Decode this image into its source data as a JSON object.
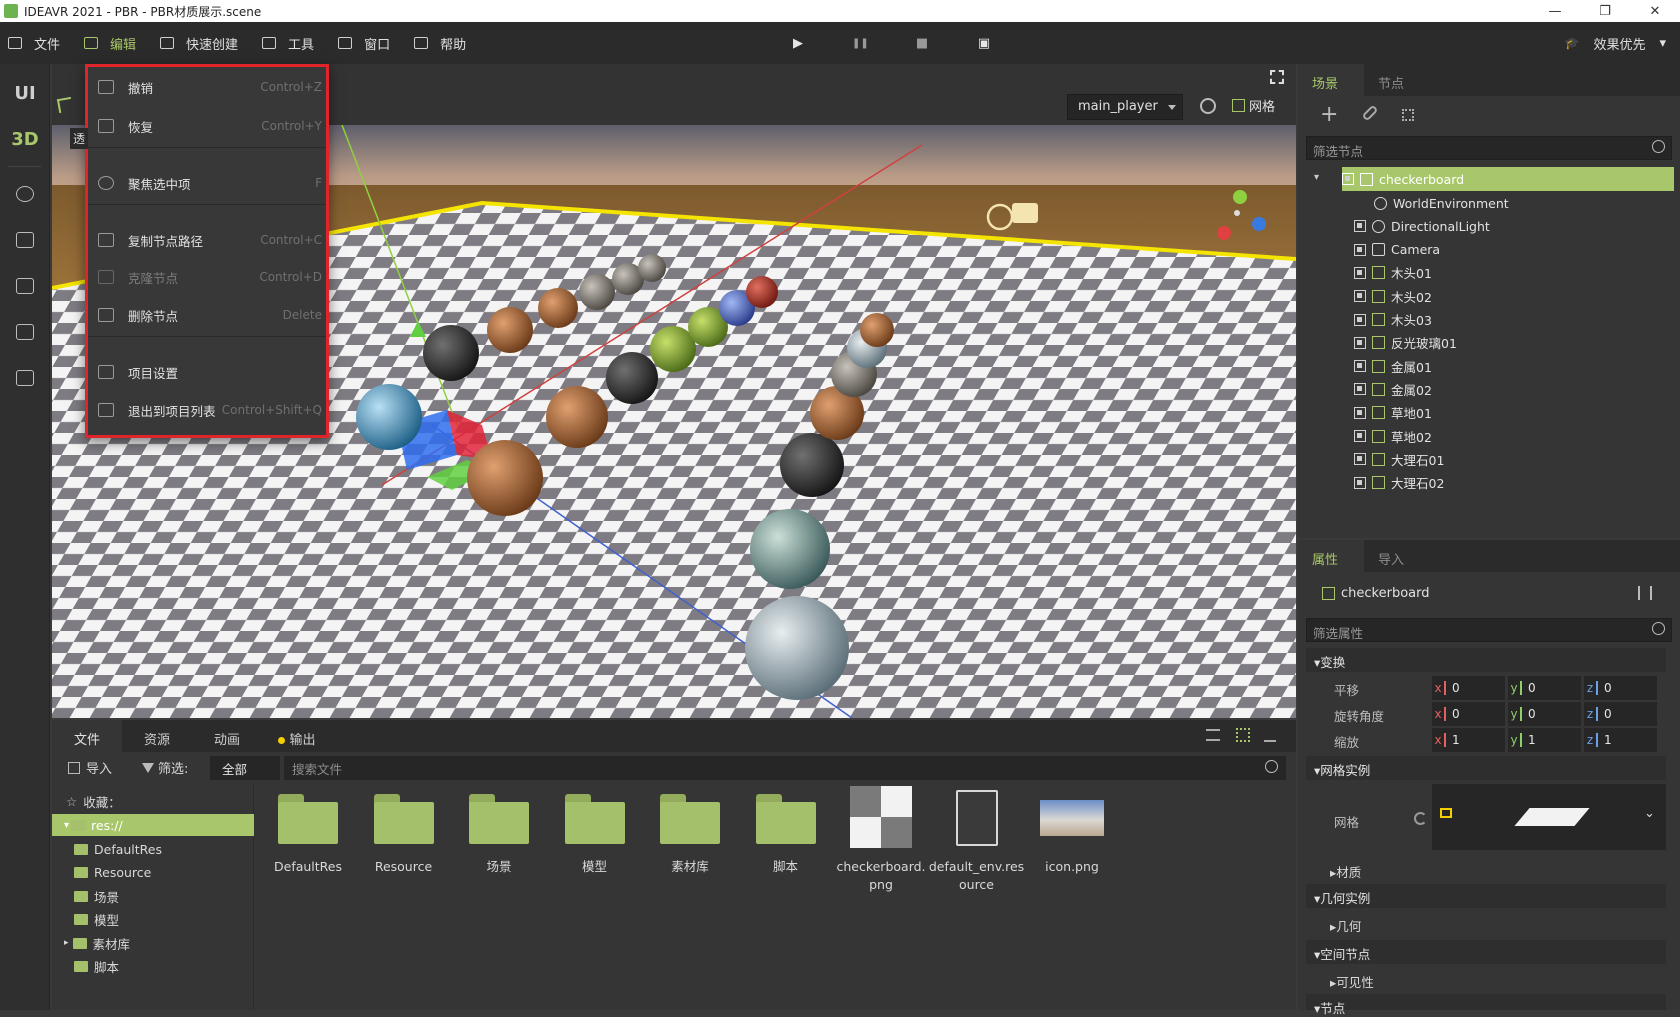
{
  "window": {
    "title": "IDEAVR 2021 - PBR - PBR材质展示.scene",
    "controls": [
      "—",
      "❐",
      "✕"
    ]
  },
  "menubar": {
    "items": [
      {
        "label": "文件",
        "icon": "folder-icon"
      },
      {
        "label": "编辑",
        "icon": "edit-icon"
      },
      {
        "label": "快速创建",
        "icon": "quick-create-icon"
      },
      {
        "label": "工具",
        "icon": "tool-icon"
      },
      {
        "label": "窗口",
        "icon": "window-icon"
      },
      {
        "label": "帮助",
        "icon": "help-icon"
      }
    ],
    "play": "▶",
    "pause": "❚❚",
    "stop": "■",
    "movie": "▣",
    "quality": "效果优先",
    "quality_caret": "▾",
    "grad_cap": "🎓"
  },
  "left_toolbar": {
    "ui": "UI",
    "three_d": "3D"
  },
  "viewport": {
    "camera_select": "main_player",
    "grid_label": "网格",
    "perspective_label": "透"
  },
  "edit_menu": {
    "items": [
      {
        "label": "撤销",
        "shortcut": "Control+Z",
        "disabled": false
      },
      {
        "label": "恢复",
        "shortcut": "Control+Y",
        "disabled": false
      },
      {
        "label": "聚焦选中项",
        "shortcut": "F",
        "disabled": false
      },
      {
        "label": "复制节点路径",
        "shortcut": "Control+C",
        "disabled": false
      },
      {
        "label": "克隆节点",
        "shortcut": "Control+D",
        "disabled": true
      },
      {
        "label": "删除节点",
        "shortcut": "Delete",
        "disabled": false
      },
      {
        "label": "项目设置",
        "shortcut": "",
        "disabled": false
      },
      {
        "label": "退出到项目列表",
        "shortcut": "Control+Shift+Q",
        "disabled": false
      }
    ]
  },
  "scene_panel": {
    "tabs": [
      "场景",
      "节点"
    ],
    "add_icon": "+",
    "filter_placeholder": "筛选节点",
    "root": "checkerboard",
    "nodes": [
      {
        "label": "WorldEnvironment",
        "icon": "globe-icon"
      },
      {
        "label": "DirectionalLight",
        "icon": "sun-icon"
      },
      {
        "label": "Camera",
        "icon": "camera-icon"
      },
      {
        "label": "木头01",
        "icon": "mesh-icon"
      },
      {
        "label": "木头02",
        "icon": "mesh-icon"
      },
      {
        "label": "木头03",
        "icon": "mesh-icon"
      },
      {
        "label": "反光玻璃01",
        "icon": "mesh-icon"
      },
      {
        "label": "金属01",
        "icon": "mesh-icon"
      },
      {
        "label": "金属02",
        "icon": "mesh-icon"
      },
      {
        "label": "草地01",
        "icon": "mesh-icon"
      },
      {
        "label": "草地02",
        "icon": "mesh-icon"
      },
      {
        "label": "大理石01",
        "icon": "mesh-icon"
      },
      {
        "label": "大理石02",
        "icon": "mesh-icon"
      }
    ]
  },
  "prop_panel": {
    "tabs": [
      "属性",
      "导入"
    ],
    "node_name": "checkerboard",
    "filter_placeholder": "筛选属性",
    "transform": {
      "title": "▾变换",
      "rows": [
        {
          "label": "平移",
          "x": "0",
          "y": "0",
          "z": "0"
        },
        {
          "label": "旋转角度",
          "x": "0",
          "y": "0",
          "z": "0"
        },
        {
          "label": "缩放",
          "x": "1",
          "y": "1",
          "z": "1"
        }
      ]
    },
    "mesh_instance": "▾网格实例",
    "mesh_label": "网格",
    "material": "▸材质",
    "geometry_instance": "▾几何实例",
    "geometry": "▸几何",
    "spatial": "▾空间节点",
    "visibility": "▸可见性",
    "node": "▾节点"
  },
  "bottom": {
    "tabs": [
      "文件",
      "资源",
      "动画",
      "输出"
    ],
    "import_label": "导入",
    "filter_label": "筛选:",
    "filter_value": "全部",
    "search_placeholder": "搜索文件",
    "favorites": "收藏：",
    "tree": [
      "res://",
      "DefaultRes",
      "Resource",
      "场景",
      "模型",
      "素材库",
      "脚本"
    ],
    "files": [
      {
        "name": "DefaultRes",
        "type": "folder"
      },
      {
        "name": "Resource",
        "type": "folder"
      },
      {
        "name": "场景",
        "type": "folder"
      },
      {
        "name": "模型",
        "type": "folder"
      },
      {
        "name": "素材库",
        "type": "folder"
      },
      {
        "name": "脚本",
        "type": "folder"
      },
      {
        "name": "checkerboard.png",
        "type": "image"
      },
      {
        "name": "default_env.resource",
        "type": "resource"
      },
      {
        "name": "icon.png",
        "type": "image"
      }
    ]
  },
  "colors": {
    "accent": "#a8c76a",
    "menu_highlight": "#e0252a",
    "grid_outline": "#f4e400"
  }
}
